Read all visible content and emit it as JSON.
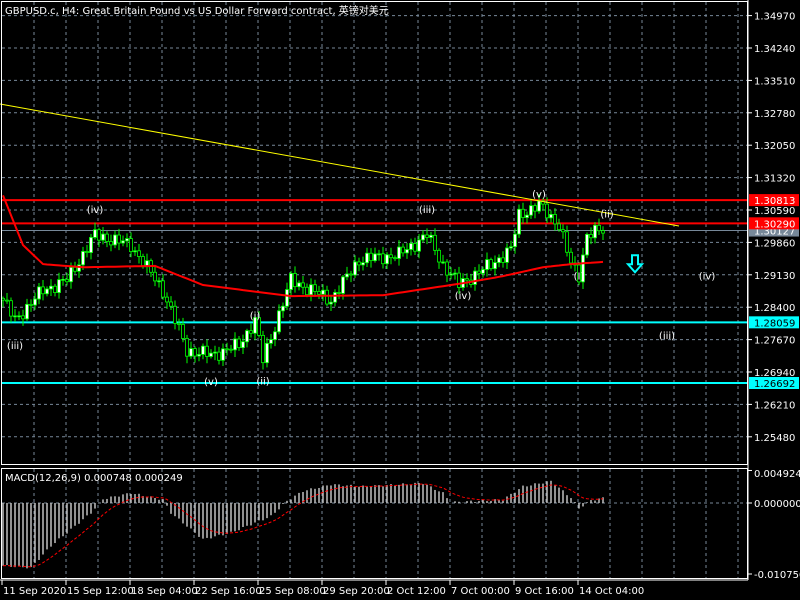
{
  "window": {
    "title": "GBPUSD.c, H4:  Great Britain Pound vs US Dollar Forward contract, 英镑对美元"
  },
  "colors": {
    "bull": "#00ff00",
    "bear": "#00ff00",
    "bull_body": "#ffffff",
    "bear_body": "#000000",
    "ma": "#ff0000",
    "trend": "#ffff00",
    "resistance": "#ff0000",
    "support": "#00ffff",
    "grid": "#778899",
    "last": "#778899"
  },
  "chart_data": {
    "type": "candlestick",
    "symbol": "GBPUSD.c",
    "timeframe": "H4",
    "ylim": [
      1.2512,
      1.3515
    ],
    "price_ticks": [
      "1.34970",
      "1.34240",
      "1.33510",
      "1.32780",
      "1.32050",
      "1.31320",
      "1.30590",
      "1.29860",
      "1.29130",
      "1.28400",
      "1.27670",
      "1.26940",
      "1.26210",
      "1.25480"
    ],
    "time_ticks": [
      "11 Sep 2020",
      "15 Sep 12:00",
      "18 Sep 04:00",
      "22 Sep 16:00",
      "25 Sep 08:00",
      "29 Sep 20:00",
      "2 Oct 12:00",
      "7 Oct 00:00",
      "9 Oct 16:00",
      "14 Oct 04:00"
    ],
    "bar_count": 151,
    "close_path": [
      [
        0,
        1.2856
      ],
      [
        3,
        1.2811
      ],
      [
        10,
        1.2878
      ],
      [
        16,
        1.2901
      ],
      [
        23,
        1.3003
      ],
      [
        32,
        1.298
      ],
      [
        40,
        1.2878
      ],
      [
        46,
        1.2743
      ],
      [
        52,
        1.2732
      ],
      [
        59,
        1.2754
      ],
      [
        63,
        1.2811
      ],
      [
        65,
        1.2721
      ],
      [
        72,
        1.2901
      ],
      [
        82,
        1.2856
      ],
      [
        89,
        1.2947
      ],
      [
        99,
        1.2958
      ],
      [
        106,
        1.3003
      ],
      [
        110,
        1.2936
      ],
      [
        114,
        1.2891
      ],
      [
        122,
        1.2936
      ],
      [
        127,
        1.297
      ],
      [
        129,
        1.3048
      ],
      [
        134,
        1.307
      ],
      [
        139,
        1.3026
      ],
      [
        142,
        1.2936
      ],
      [
        144,
        1.2913
      ],
      [
        146,
        1.3003
      ],
      [
        150,
        1.3013
      ]
    ],
    "ma_path": [
      [
        0,
        1.3092
      ],
      [
        5,
        1.298
      ],
      [
        10,
        1.2937
      ],
      [
        20,
        1.293
      ],
      [
        38,
        1.2933
      ],
      [
        50,
        1.289
      ],
      [
        72,
        1.2865
      ],
      [
        95,
        1.2867
      ],
      [
        115,
        1.2894
      ],
      [
        125,
        1.291
      ],
      [
        135,
        1.293
      ],
      [
        142,
        1.2937
      ],
      [
        150,
        1.2942
      ]
    ],
    "trendline": {
      "from": [
        0,
        1.32978
      ],
      "to": [
        169,
        1.3023
      ]
    },
    "horizontal_levels": [
      {
        "price": 1.30813,
        "label": "1.30813",
        "kind": "resistance"
      },
      {
        "price": 1.3029,
        "label": "1.30290",
        "kind": "resistance"
      },
      {
        "price": 1.28059,
        "label": "1.28059",
        "kind": "support"
      },
      {
        "price": 1.26692,
        "label": "1.26692",
        "kind": "support"
      }
    ],
    "last_price": {
      "price": 1.30127,
      "label": "1.30127"
    },
    "wave_labels": [
      {
        "text": "(iii)",
        "bar": 3,
        "price": 1.2757
      },
      {
        "text": "(iv)",
        "bar": 23,
        "price": 1.3063
      },
      {
        "text": "(v)",
        "bar": 52,
        "price": 1.2676
      },
      {
        "text": "(i)",
        "bar": 63,
        "price": 1.2825
      },
      {
        "text": "(ii)",
        "bar": 65,
        "price": 1.2677
      },
      {
        "text": "(iii)",
        "bar": 106,
        "price": 1.3063
      },
      {
        "text": "(iv)",
        "bar": 115,
        "price": 1.287
      },
      {
        "text": "(v)",
        "bar": 134,
        "price": 1.3098
      },
      {
        "text": "(I)",
        "bar": 144,
        "price": 1.2914
      },
      {
        "text": "(ii)",
        "bar": 151,
        "price": 1.3053
      },
      {
        "text": "(iii)",
        "bar": 166,
        "price": 1.278
      },
      {
        "text": "(iv)",
        "bar": 176,
        "price": 1.2914
      }
    ],
    "arrow": {
      "direction": "down",
      "bar": 158,
      "price": 1.293
    },
    "macd": {
      "label": "MACD(12,26,9) 0.000748 0.000249",
      "params": [
        12,
        26,
        9
      ],
      "value": 0.000748,
      "signal": 0.000249,
      "ylim": [
        -0.01075,
        0.004924
      ],
      "ticks": [
        "0.004924",
        "0.000000",
        "-0.010750"
      ],
      "hist_path": [
        [
          0,
          -0.0095
        ],
        [
          7,
          -0.0098
        ],
        [
          12,
          -0.0065
        ],
        [
          17,
          -0.004
        ],
        [
          22,
          -0.0015
        ],
        [
          25,
          0.0006
        ],
        [
          32,
          0.0015
        ],
        [
          40,
          0.0005
        ],
        [
          42,
          -0.0015
        ],
        [
          50,
          -0.0055
        ],
        [
          57,
          -0.0045
        ],
        [
          67,
          -0.002
        ],
        [
          71,
          0.0003
        ],
        [
          75,
          0.0018
        ],
        [
          82,
          0.0028
        ],
        [
          90,
          0.0025
        ],
        [
          105,
          0.003
        ],
        [
          110,
          0.0015
        ],
        [
          112,
          0.0001
        ],
        [
          125,
          0.0005
        ],
        [
          130,
          0.0025
        ],
        [
          137,
          0.0033
        ],
        [
          142,
          0.0008
        ],
        [
          144,
          -0.0008
        ],
        [
          147,
          0.0004
        ],
        [
          150,
          0.00075
        ]
      ]
    }
  }
}
